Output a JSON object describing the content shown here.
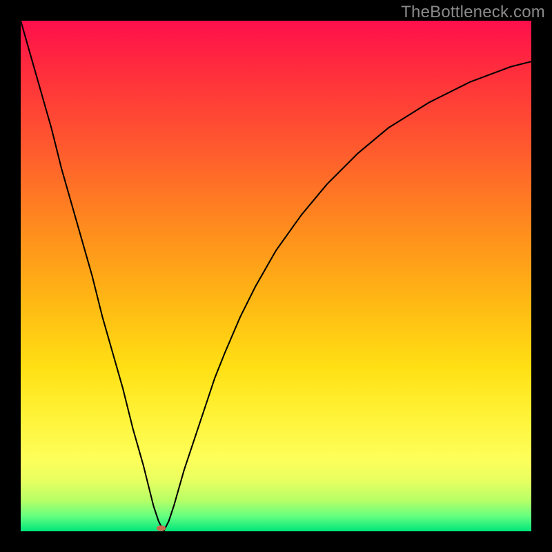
{
  "watermark": "TheBottleneck.com",
  "chart_data": {
    "type": "line",
    "title": "",
    "xlabel": "",
    "ylabel": "",
    "xlim": [
      0,
      100
    ],
    "ylim": [
      0,
      100
    ],
    "grid": false,
    "legend": false,
    "background_gradient": {
      "direction": "vertical",
      "stops": [
        {
          "pos": 0.0,
          "color": "#ff0f4c"
        },
        {
          "pos": 0.1,
          "color": "#ff2e3c"
        },
        {
          "pos": 0.25,
          "color": "#ff5a2e"
        },
        {
          "pos": 0.4,
          "color": "#ff8a1e"
        },
        {
          "pos": 0.55,
          "color": "#ffb814"
        },
        {
          "pos": 0.68,
          "color": "#ffe014"
        },
        {
          "pos": 0.78,
          "color": "#fff43a"
        },
        {
          "pos": 0.86,
          "color": "#fdff5a"
        },
        {
          "pos": 0.9,
          "color": "#e8ff60"
        },
        {
          "pos": 0.94,
          "color": "#b6ff66"
        },
        {
          "pos": 0.97,
          "color": "#66ff80"
        },
        {
          "pos": 1.0,
          "color": "#00e57a"
        }
      ]
    },
    "series": [
      {
        "name": "bottleneck-curve",
        "color": "#000000",
        "stroke_width": 2,
        "x": [
          0,
          2,
          4,
          6,
          8,
          10,
          12,
          14,
          16,
          18,
          20,
          22,
          24,
          26,
          27,
          28,
          29,
          30,
          32,
          34,
          36,
          38,
          40,
          43,
          46,
          50,
          55,
          60,
          66,
          72,
          80,
          88,
          96,
          100
        ],
        "y": [
          100,
          93,
          86,
          79,
          71,
          64,
          57,
          50,
          42,
          35,
          28,
          20,
          13,
          5,
          2,
          0,
          2,
          5,
          12,
          18,
          24,
          30,
          35,
          42,
          48,
          55,
          62,
          68,
          74,
          79,
          84,
          88,
          91,
          92
        ]
      }
    ],
    "markers": [
      {
        "name": "optimal-point",
        "x": 27.5,
        "y": 0.6,
        "rx": 0.9,
        "ry": 0.55,
        "color": "#c86a4f"
      }
    ]
  }
}
